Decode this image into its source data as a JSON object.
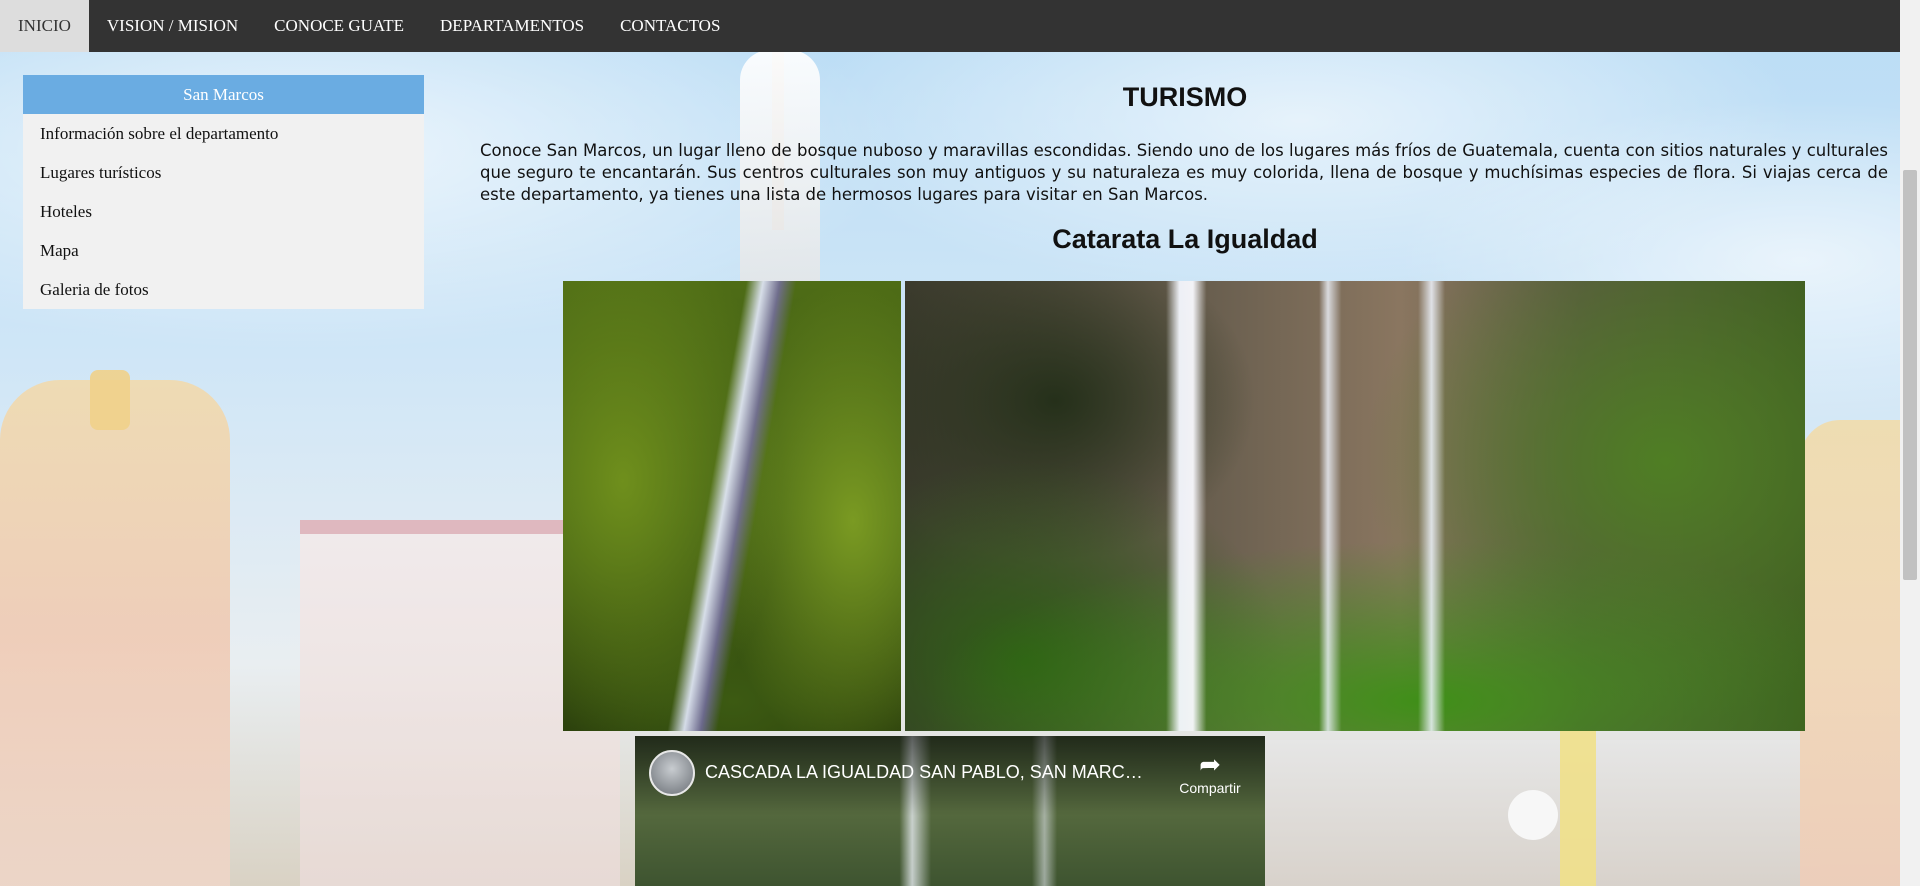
{
  "nav": {
    "items": [
      {
        "label": "INICIO",
        "active": true
      },
      {
        "label": "VISION / MISION"
      },
      {
        "label": "CONOCE GUATE"
      },
      {
        "label": "DEPARTAMENTOS"
      },
      {
        "label": "CONTACTOS"
      }
    ]
  },
  "sidebar": {
    "header": "San Marcos",
    "items": [
      {
        "label": "Información sobre el departamento"
      },
      {
        "label": "Lugares turísticos"
      },
      {
        "label": "Hoteles"
      },
      {
        "label": "Mapa"
      },
      {
        "label": "Galeria de fotos"
      }
    ]
  },
  "main": {
    "title": "TURISMO",
    "paragraph": "Conoce San Marcos, un lugar lleno de bosque nuboso y maravillas escondidas. Siendo uno de los lugares más fríos de Guatemala, cuenta con sitios naturales y culturales que seguro te encantarán. Sus centros culturales son muy antiguos y su naturaleza es muy colorida, llena de bosque y muchísimas especies de flora. Si viajas cerca de este departamento, ya tienes una lista de hermosos lugares para visitar en San Marcos.",
    "subtitle": "Catarata La Igualdad"
  },
  "video": {
    "title": "CASCADA LA IGUALDAD SAN PABLO, SAN MARCOS",
    "share_label": "Compartir",
    "share_icon": "share-arrow-icon"
  },
  "colors": {
    "nav_bg": "#333333",
    "nav_active": "#dddddd",
    "sidebar_header": "#6aace2",
    "sidebar_bg": "#f1f1f1"
  }
}
